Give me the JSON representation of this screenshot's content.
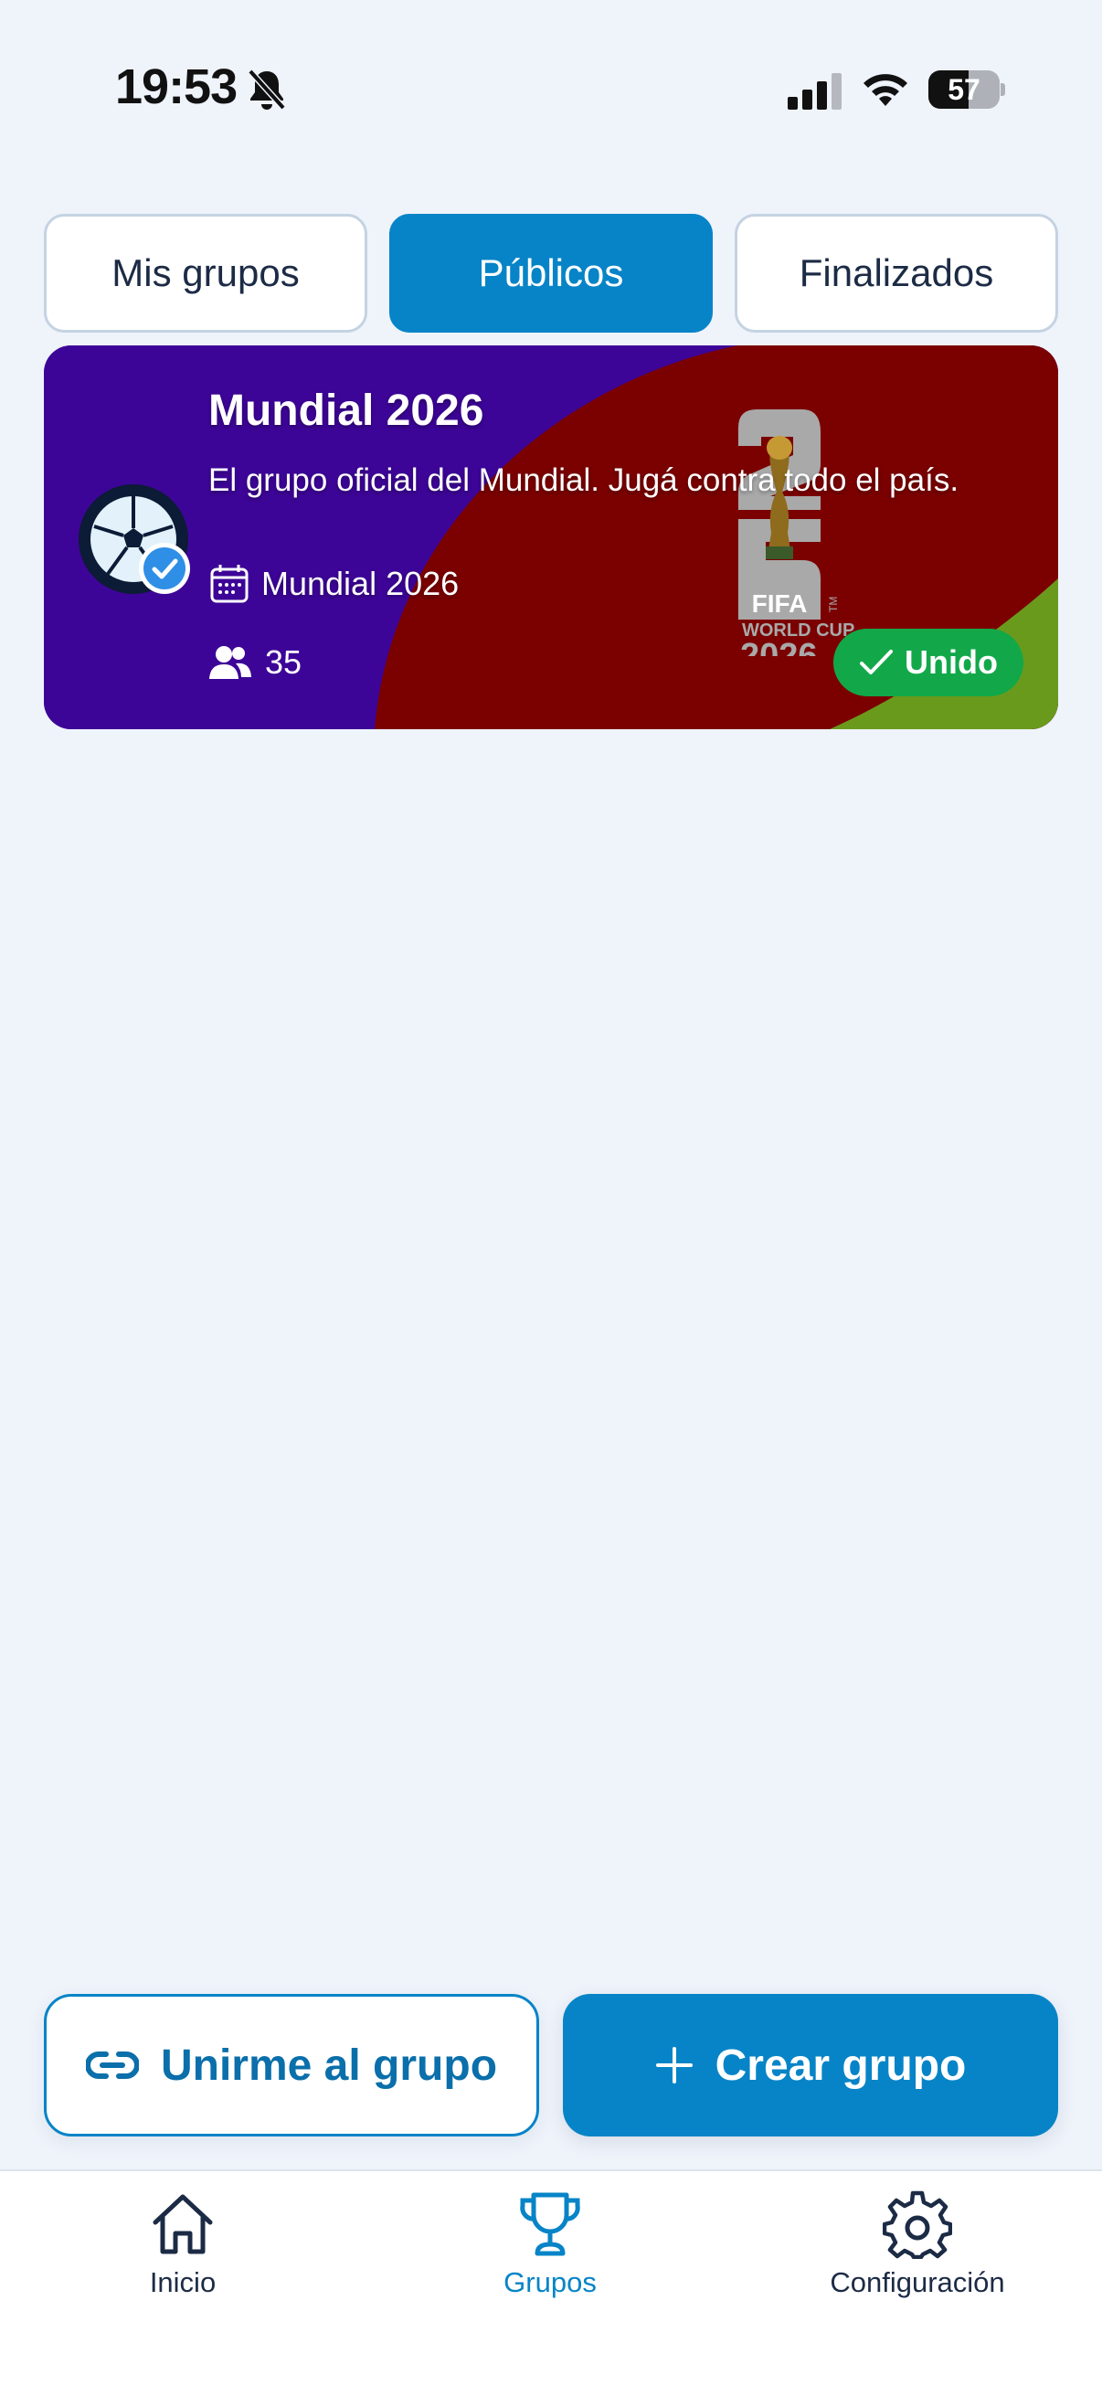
{
  "status_bar": {
    "time": "19:53",
    "battery_level": 57,
    "battery_text": "57",
    "icons": [
      "bell-slash-icon",
      "signal-icon",
      "wifi-icon",
      "battery-icon"
    ]
  },
  "tabs": [
    {
      "label": "Mis grupos",
      "active": false
    },
    {
      "label": "Públicos",
      "active": true
    },
    {
      "label": "Finalizados",
      "active": false
    }
  ],
  "group_card": {
    "title": "Mundial 2026",
    "description": "El grupo oficial del Mundial. Jugá contra todo el país.",
    "tournament": "Mundial 2026",
    "members": "35",
    "status": "Unido",
    "logo": {
      "line1": "FIFA",
      "line2": "WORLD CUP",
      "line3": "2026",
      "tm": "TM"
    },
    "colors": {
      "purple": "#3d0597",
      "red": "#7b0101",
      "green": "#6a9a1c",
      "badge": "#12a84a"
    }
  },
  "actions": {
    "join_label": "Unirme al grupo",
    "create_label": "Crear grupo"
  },
  "nav": [
    {
      "label": "Inicio",
      "icon": "home-icon",
      "active": false
    },
    {
      "label": "Grupos",
      "icon": "trophy-icon",
      "active": true
    },
    {
      "label": "Configuración",
      "icon": "gear-icon",
      "active": false
    }
  ],
  "colors": {
    "accent": "#0784c7",
    "background": "#eff3fa",
    "text": "#1c2b45"
  }
}
